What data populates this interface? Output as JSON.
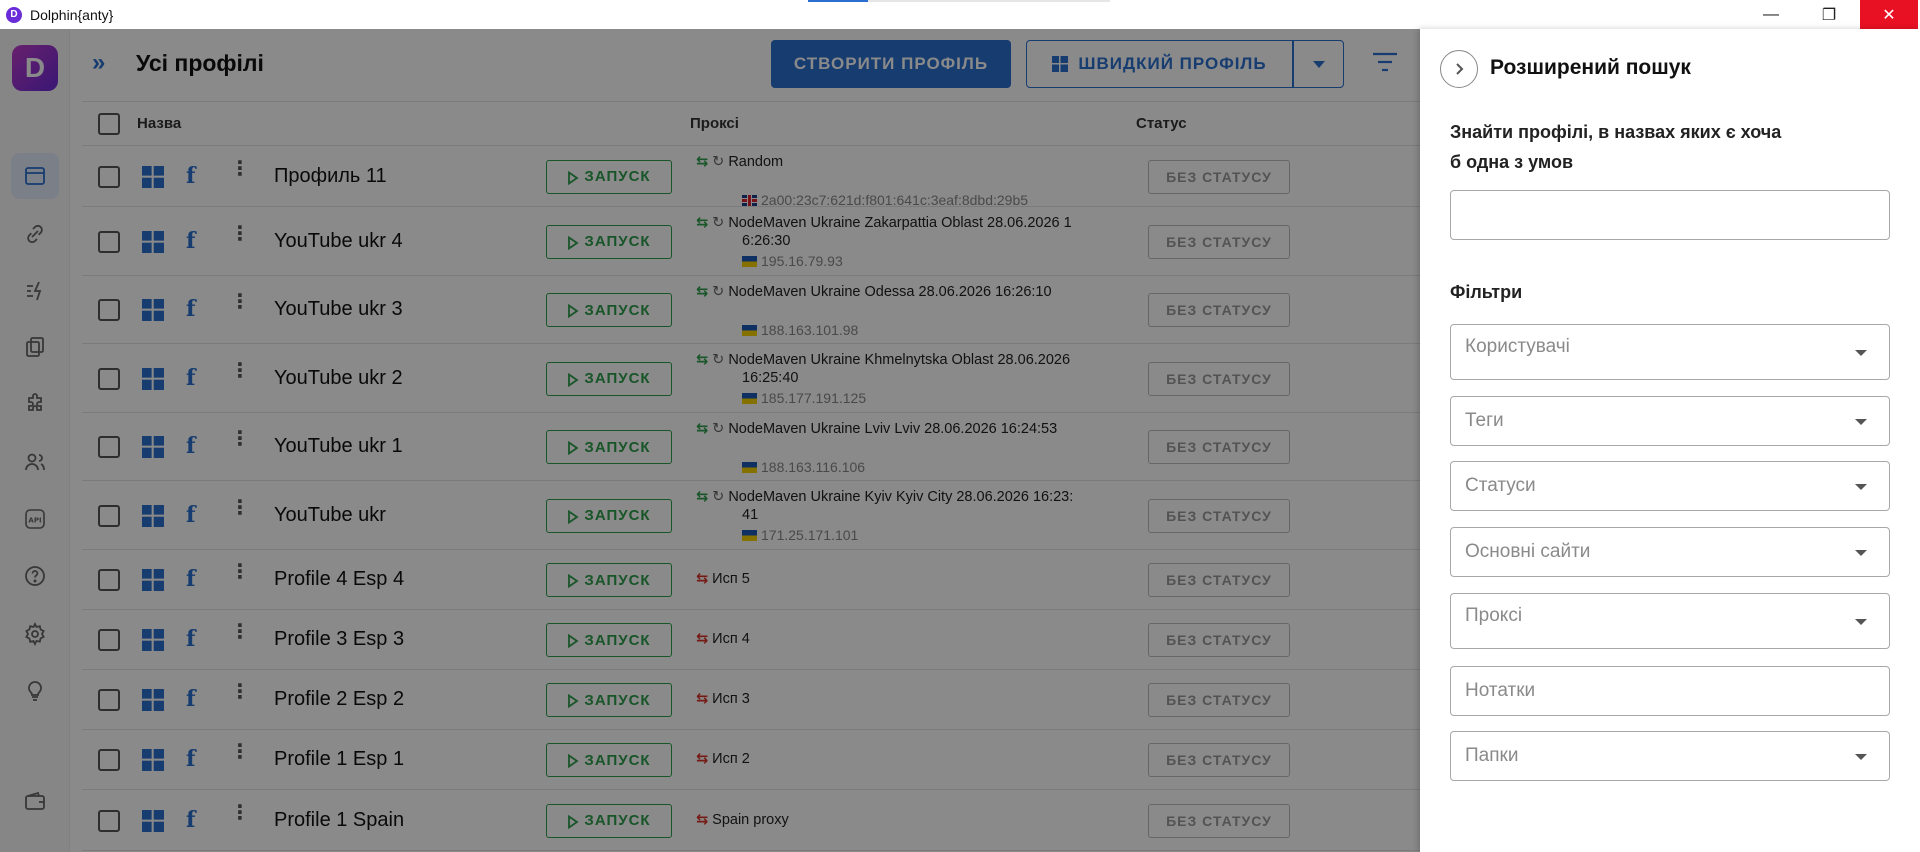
{
  "window": {
    "title": "Dolphin{anty}",
    "logo_letter": "D"
  },
  "sidebar": {
    "logo_letter": "D",
    "items": [
      {
        "icon": "browser-icon",
        "active": true
      },
      {
        "icon": "link-icon"
      },
      {
        "icon": "automation-icon"
      },
      {
        "icon": "copy-icon"
      },
      {
        "icon": "extension-icon"
      },
      {
        "icon": "users-icon"
      },
      {
        "icon": "api-icon",
        "label": "API"
      },
      {
        "icon": "help-icon"
      },
      {
        "icon": "gear-icon"
      },
      {
        "icon": "lightbulb-icon"
      },
      {
        "icon": "wallet-icon"
      }
    ]
  },
  "header": {
    "title": "Усі профілі",
    "create_label": "СТВОРИТИ ПРОФІЛЬ",
    "quick_label": "ШВИДКИЙ ПРОФІЛЬ"
  },
  "table": {
    "columns": {
      "name": "Назва",
      "proxy": "Проксі",
      "status": "Статус"
    },
    "run_label": "ЗАПУСК",
    "status_label": "БЕЗ СТАТУСУ",
    "rows": [
      {
        "name": "Профиль 11",
        "proxy_line1": "Random",
        "proxy_line2": "",
        "ip": "2a00:23c7:621d:f801:641c:3eaf:8dbd:29b5",
        "flag": "gb",
        "swap": "g",
        "refresh": true
      },
      {
        "name": "YouTube ukr 4",
        "proxy_line1": "NodeMaven Ukraine Zakarpattia Oblast 28.06.2026 1",
        "proxy_line2": "6:26:30",
        "ip": "195.16.79.93",
        "flag": "ua",
        "swap": "g",
        "refresh": true
      },
      {
        "name": "YouTube ukr 3",
        "proxy_line1": "NodeMaven Ukraine Odessa 28.06.2026 16:26:10",
        "proxy_line2": "",
        "ip": "188.163.101.98",
        "flag": "ua",
        "swap": "g",
        "refresh": true
      },
      {
        "name": "YouTube ukr 2",
        "proxy_line1": "NodeMaven Ukraine Khmelnytska Oblast 28.06.2026",
        "proxy_line2": "16:25:40",
        "ip": "185.177.191.125",
        "flag": "ua",
        "swap": "g",
        "refresh": true
      },
      {
        "name": "YouTube ukr 1",
        "proxy_line1": "NodeMaven Ukraine Lviv Lviv 28.06.2026 16:24:53",
        "proxy_line2": "",
        "ip": "188.163.116.106",
        "flag": "ua",
        "swap": "g",
        "refresh": true
      },
      {
        "name": "YouTube ukr",
        "proxy_line1": "NodeMaven Ukraine Kyiv Kyiv City 28.06.2026 16:23:",
        "proxy_line2": "41",
        "ip": "171.25.171.101",
        "flag": "ua",
        "swap": "g",
        "refresh": true
      },
      {
        "name": "Profile 4 Esp 4",
        "proxy_line1": "Исп 5",
        "swap": "r"
      },
      {
        "name": "Profile 3 Esp 3",
        "proxy_line1": "Исп 4",
        "swap": "r"
      },
      {
        "name": "Profile 2 Esp 2",
        "proxy_line1": "Исп 3",
        "swap": "r"
      },
      {
        "name": "Profile 1 Esp 1",
        "proxy_line1": "Исп 2",
        "swap": "r"
      },
      {
        "name": "Profile 1 Spain",
        "proxy_line1": "Spain proxy",
        "swap": "r"
      }
    ]
  },
  "panel": {
    "title": "Розширений пошук",
    "subtitle": "Знайти профілі, в назвах яких є хоча б одна з умов",
    "search_value": "",
    "filters_label": "Фільтри",
    "fields": [
      {
        "label": "Користувачі",
        "dropdown": true
      },
      {
        "label": "Теги",
        "dropdown": true
      },
      {
        "label": "Статуси",
        "dropdown": true
      },
      {
        "label": "Основні сайти",
        "dropdown": true
      },
      {
        "label": "Проксі",
        "dropdown": true
      },
      {
        "label": "Нотатки",
        "dropdown": false
      },
      {
        "label": "Папки",
        "dropdown": true
      }
    ]
  }
}
